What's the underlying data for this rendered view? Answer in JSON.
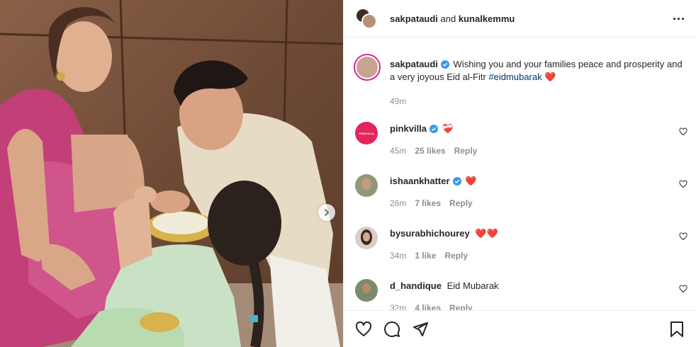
{
  "header": {
    "user1": "sakpataudi",
    "joiner": "and",
    "user2": "kunalkemmu"
  },
  "caption": {
    "username": "sakpataudi",
    "text": "Wishing you and your families peace and prosperity and a very joyous Eid al-Fitr",
    "hashtag": "#eidmubarak",
    "emoji": "❤️",
    "time": "49m"
  },
  "comments": [
    {
      "username": "pinkvilla",
      "verified": true,
      "text": "❤️‍🩹",
      "time": "45m",
      "likes": "25 likes",
      "reply": "Reply",
      "avatar_text": "PINKVILLA"
    },
    {
      "username": "ishaankhatter",
      "verified": true,
      "text": "❤️",
      "time": "26m",
      "likes": "7 likes",
      "reply": "Reply"
    },
    {
      "username": "bysurabhichourey",
      "verified": false,
      "text": "❤️❤️",
      "time": "34m",
      "likes": "1 like",
      "reply": "Reply"
    },
    {
      "username": "d_handique",
      "verified": false,
      "text": "Eid Mubarak",
      "time": "32m",
      "likes": "4 likes",
      "reply": "Reply"
    }
  ],
  "colors": {
    "verified": "#3897f0",
    "heart": "#ed4956",
    "hashtag": "#00376b",
    "muted": "#8e8e8e"
  },
  "icons": [
    "chevron-right-icon",
    "more-options-icon",
    "heart-icon",
    "comment-icon",
    "share-icon",
    "bookmark-icon",
    "verified-icon"
  ]
}
